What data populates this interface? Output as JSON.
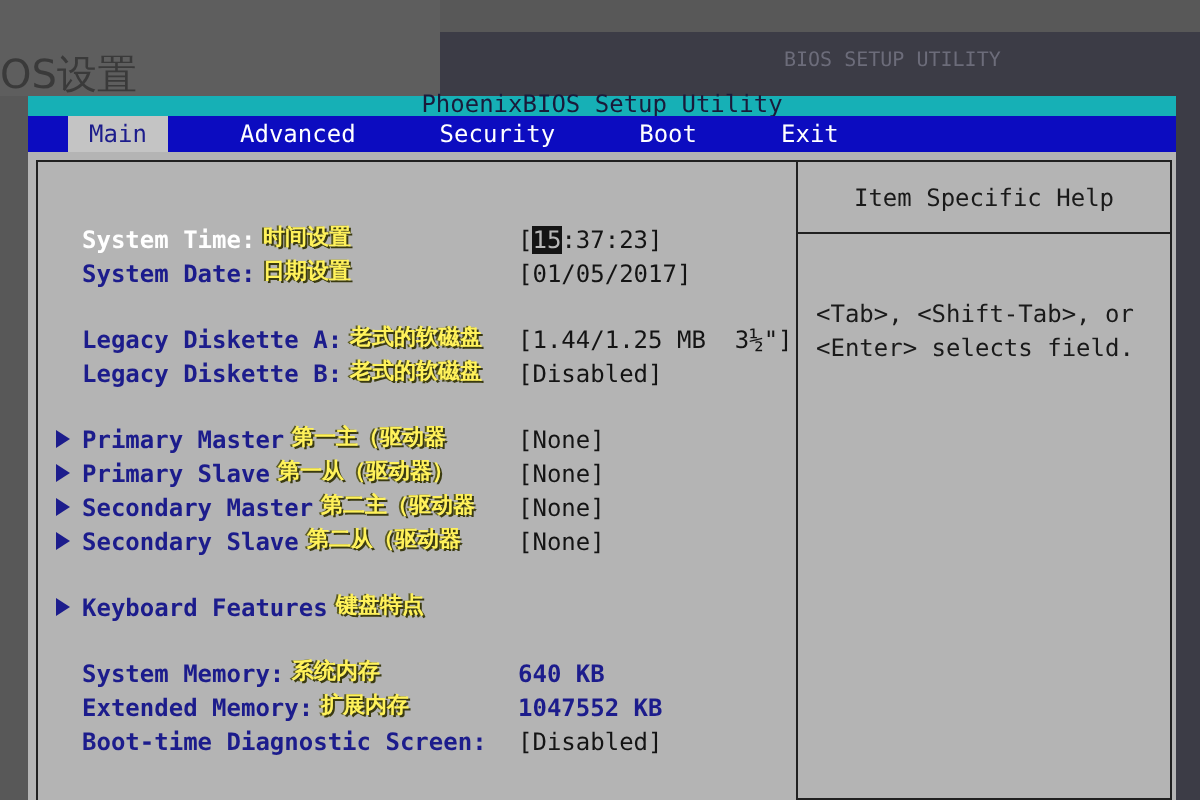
{
  "background": {
    "heading": "OS设置",
    "second_window_title": "BIOS SETUP UTILITY"
  },
  "window": {
    "title": "PhoenixBIOS Setup Utility"
  },
  "tabs": [
    {
      "label": "Main",
      "selected": true
    },
    {
      "label": "Advanced",
      "selected": false
    },
    {
      "label": "Security",
      "selected": false
    },
    {
      "label": "Boot",
      "selected": false
    },
    {
      "label": "Exit",
      "selected": false
    }
  ],
  "groups": [
    {
      "rows": [
        {
          "kind": "field",
          "label": "System Time:",
          "note": "时间设置",
          "selected": true,
          "value_segments": [
            {
              "text": "[",
              "highlighted": false
            },
            {
              "text": "15",
              "highlighted": true
            },
            {
              "text": ":37:23]",
              "highlighted": false
            }
          ]
        },
        {
          "kind": "field",
          "label": "System Date:",
          "note": "日期设置",
          "selected": false,
          "value": "[01/05/2017]"
        }
      ]
    },
    {
      "rows": [
        {
          "kind": "field",
          "label": "Legacy Diskette A:",
          "note": "老式的软磁盘",
          "selected": false,
          "value": "[1.44/1.25 MB  3½\"]"
        },
        {
          "kind": "field",
          "label": "Legacy Diskette B:",
          "note": "老式的软磁盘",
          "selected": false,
          "value": "[Disabled]"
        }
      ]
    },
    {
      "rows": [
        {
          "kind": "submenu",
          "label": "Primary Master",
          "note": "第一主（驱动器",
          "selected": false,
          "value": "[None]"
        },
        {
          "kind": "submenu",
          "label": "Primary Slave",
          "note": "第一从（驱动器）",
          "selected": false,
          "value": "[None]"
        },
        {
          "kind": "submenu",
          "label": "Secondary Master",
          "note": "第二主（驱动器",
          "selected": false,
          "value": "[None]"
        },
        {
          "kind": "submenu",
          "label": "Secondary Slave",
          "note": "第二从（驱动器",
          "selected": false,
          "value": "[None]"
        }
      ]
    },
    {
      "rows": [
        {
          "kind": "submenu",
          "label": "Keyboard Features",
          "note": "键盘特点",
          "selected": false
        }
      ]
    },
    {
      "rows": [
        {
          "kind": "field",
          "label": "System Memory:",
          "note": "系统内存",
          "selected": false,
          "value": "640 KB"
        },
        {
          "kind": "field",
          "label": "Extended Memory:",
          "note": "扩展内存",
          "selected": false,
          "value": "1047552 KB"
        },
        {
          "kind": "field",
          "label": "Boot-time Diagnostic Screen:",
          "selected": false,
          "value": "[Disabled]"
        }
      ]
    }
  ],
  "help": {
    "title": "Item Specific Help",
    "text": "<Tab>, <Shift-Tab>, or <Enter> selects field."
  }
}
